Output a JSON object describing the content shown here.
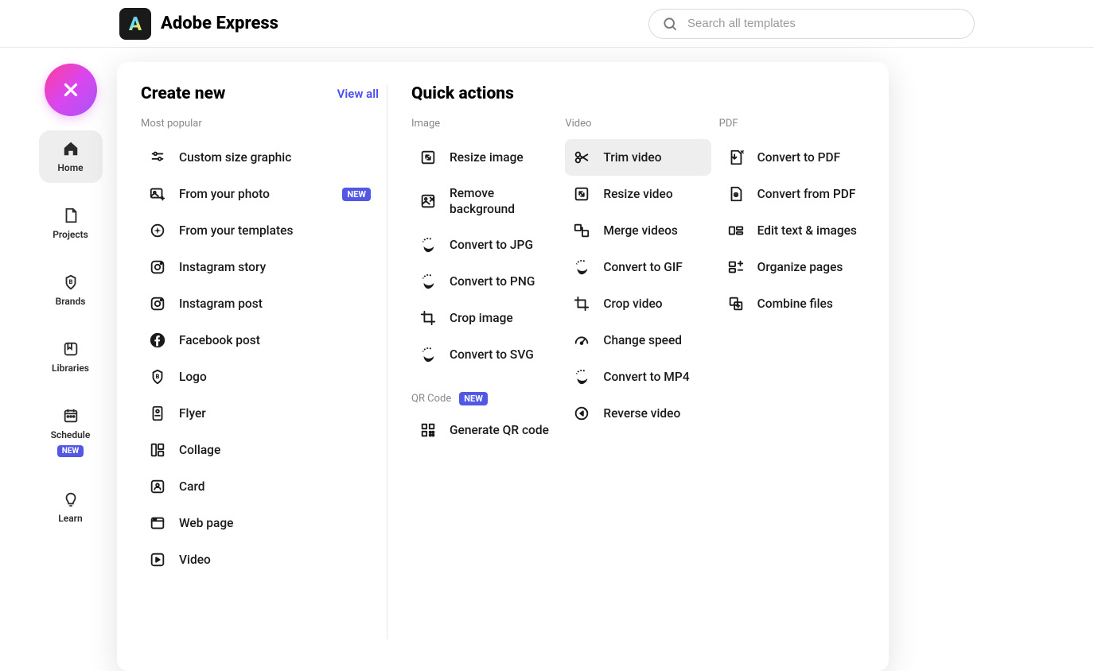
{
  "brand": {
    "name": "Adobe Express"
  },
  "search": {
    "placeholder": "Search all templates"
  },
  "sidebar": {
    "items": [
      {
        "id": "home",
        "label": "Home",
        "active": true
      },
      {
        "id": "projects",
        "label": "Projects"
      },
      {
        "id": "brands",
        "label": "Brands"
      },
      {
        "id": "libraries",
        "label": "Libraries"
      },
      {
        "id": "schedule",
        "label": "Schedule",
        "badge": "NEW"
      },
      {
        "id": "learn",
        "label": "Learn"
      }
    ]
  },
  "create": {
    "title": "Create new",
    "view_all": "View all",
    "subhead": "Most popular",
    "items": [
      {
        "label": "Custom size graphic",
        "icon": "sliders"
      },
      {
        "label": "From your photo",
        "icon": "photo-plus",
        "badge": "NEW"
      },
      {
        "label": "From your templates",
        "icon": "template-sparkle"
      },
      {
        "label": "Instagram story",
        "icon": "instagram"
      },
      {
        "label": "Instagram post",
        "icon": "instagram"
      },
      {
        "label": "Facebook post",
        "icon": "facebook"
      },
      {
        "label": "Logo",
        "icon": "logo-b"
      },
      {
        "label": "Flyer",
        "icon": "flyer"
      },
      {
        "label": "Collage",
        "icon": "collage"
      },
      {
        "label": "Card",
        "icon": "card"
      },
      {
        "label": "Web page",
        "icon": "webpage"
      },
      {
        "label": "Video",
        "icon": "play"
      }
    ]
  },
  "quick": {
    "title": "Quick actions",
    "columns": [
      {
        "heading": "Image",
        "items": [
          {
            "label": "Resize image",
            "icon": "resize"
          },
          {
            "label": "Remove background",
            "icon": "remove-bg"
          },
          {
            "label": "Convert to JPG",
            "icon": "convert"
          },
          {
            "label": "Convert to PNG",
            "icon": "convert"
          },
          {
            "label": "Crop image",
            "icon": "crop"
          },
          {
            "label": "Convert to SVG",
            "icon": "convert"
          }
        ],
        "qr": {
          "heading": "QR Code",
          "badge": "NEW",
          "item": {
            "label": "Generate QR code",
            "icon": "qr"
          }
        }
      },
      {
        "heading": "Video",
        "items": [
          {
            "label": "Trim video",
            "icon": "trim",
            "hovered": true
          },
          {
            "label": "Resize video",
            "icon": "resize"
          },
          {
            "label": "Merge videos",
            "icon": "merge"
          },
          {
            "label": "Convert to GIF",
            "icon": "convert"
          },
          {
            "label": "Crop video",
            "icon": "crop"
          },
          {
            "label": "Change speed",
            "icon": "speed"
          },
          {
            "label": "Convert to MP4",
            "icon": "convert"
          },
          {
            "label": "Reverse video",
            "icon": "reverse"
          }
        ]
      },
      {
        "heading": "PDF",
        "items": [
          {
            "label": "Convert to PDF",
            "icon": "to-pdf"
          },
          {
            "label": "Convert from PDF",
            "icon": "from-pdf"
          },
          {
            "label": "Edit text & images",
            "icon": "edit"
          },
          {
            "label": "Organize pages",
            "icon": "organize"
          },
          {
            "label": "Combine files",
            "icon": "combine"
          }
        ]
      }
    ]
  }
}
